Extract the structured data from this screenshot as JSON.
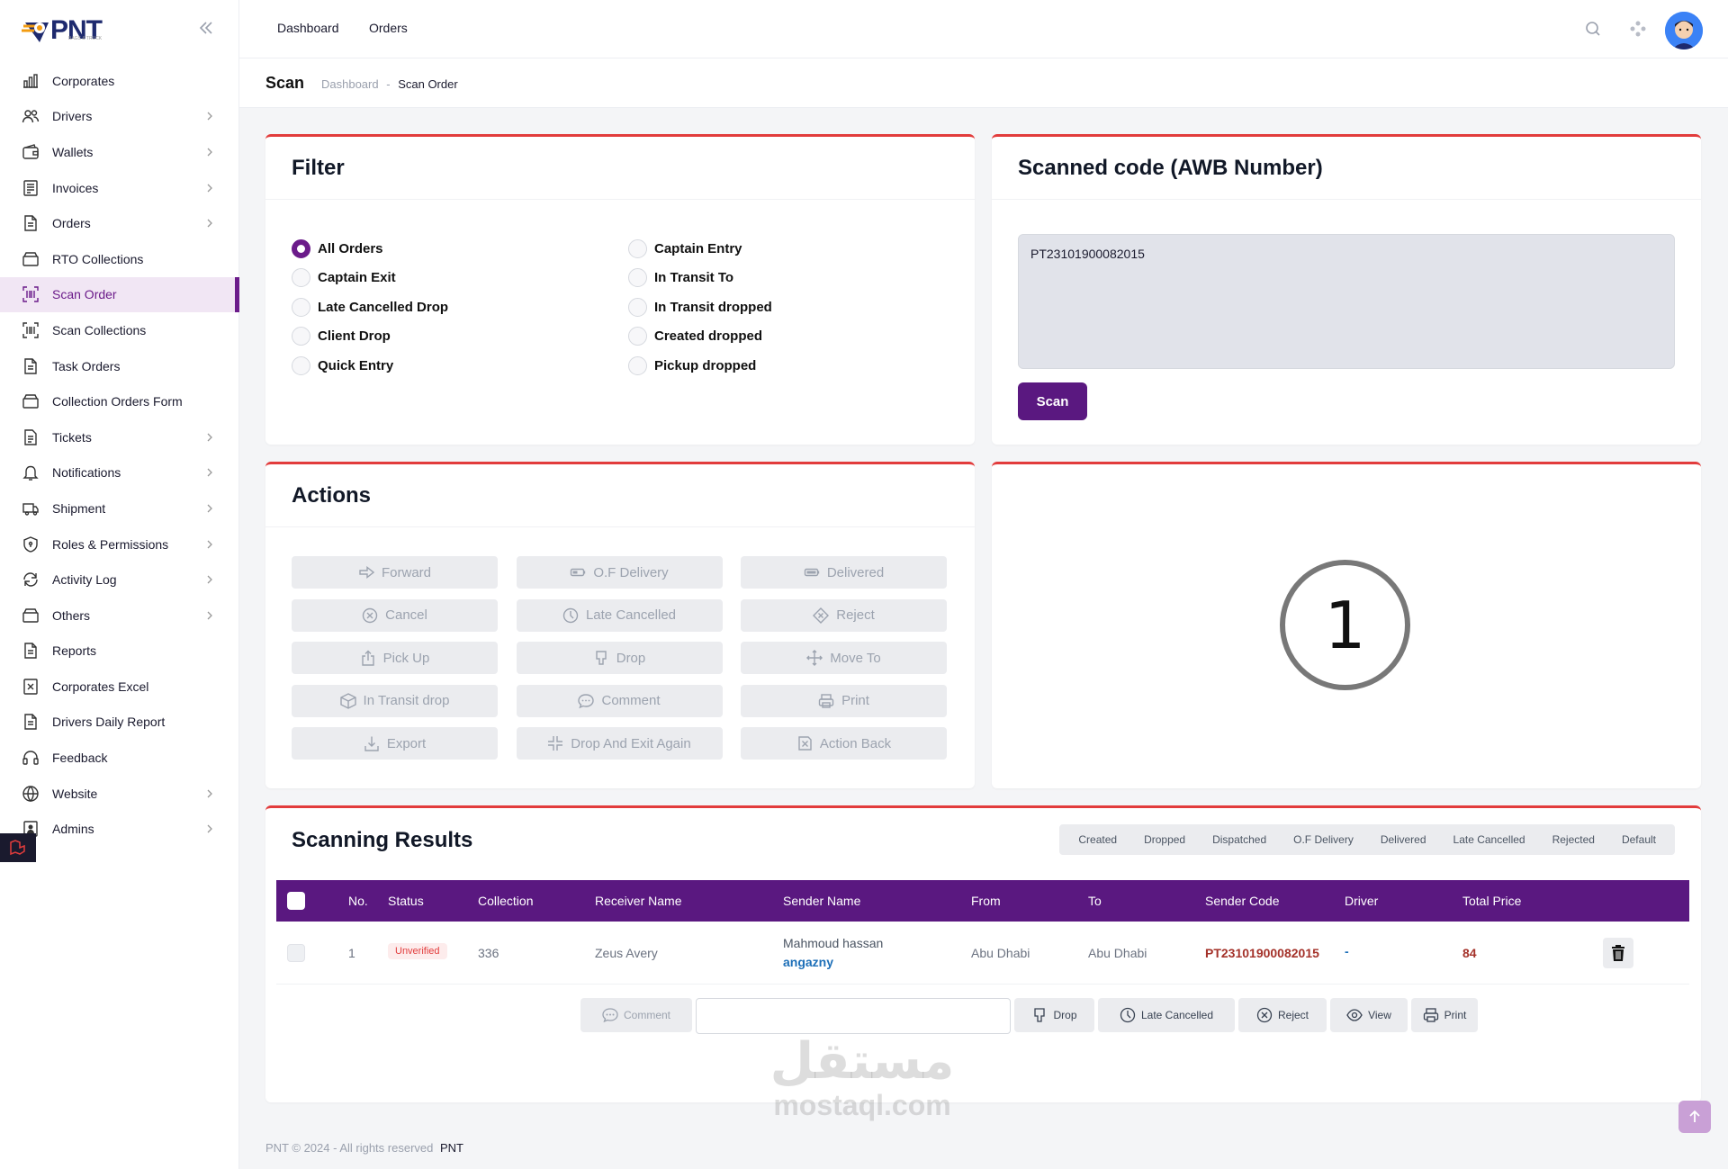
{
  "brand": {
    "logo_text": "PNT",
    "logo_sub": "BAGS & TRUCK",
    "accent": "#5a1880",
    "card_border": "#e23c3c"
  },
  "sidebar": {
    "items": [
      {
        "label": "Corporates",
        "icon": "chart-icon",
        "chevron": false
      },
      {
        "label": "Drivers",
        "icon": "users-icon",
        "chevron": true
      },
      {
        "label": "Wallets",
        "icon": "wallet-icon",
        "chevron": true
      },
      {
        "label": "Invoices",
        "icon": "invoice-icon",
        "chevron": true
      },
      {
        "label": "Orders",
        "icon": "document-icon",
        "chevron": true
      },
      {
        "label": "RTO Collections",
        "icon": "box-icon",
        "chevron": false
      },
      {
        "label": "Scan Order",
        "icon": "barcode-icon",
        "chevron": false,
        "active": true
      },
      {
        "label": "Scan Collections",
        "icon": "barcode-icon",
        "chevron": false
      },
      {
        "label": "Task Orders",
        "icon": "document-icon",
        "chevron": false
      },
      {
        "label": "Collection Orders Form",
        "icon": "box-icon",
        "chevron": false
      },
      {
        "label": "Tickets",
        "icon": "ticket-icon",
        "chevron": true
      },
      {
        "label": "Notifications",
        "icon": "bell-icon",
        "chevron": true
      },
      {
        "label": "Shipment",
        "icon": "truck-icon",
        "chevron": true
      },
      {
        "label": "Roles & Permissions",
        "icon": "shield-icon",
        "chevron": true
      },
      {
        "label": "Activity Log",
        "icon": "refresh-icon",
        "chevron": true
      },
      {
        "label": "Others",
        "icon": "box-icon",
        "chevron": true
      },
      {
        "label": "Reports",
        "icon": "document-icon",
        "chevron": false
      },
      {
        "label": "Corporates Excel",
        "icon": "excel-icon",
        "chevron": false
      },
      {
        "label": "Drivers Daily Report",
        "icon": "document-icon",
        "chevron": false
      },
      {
        "label": "Feedback",
        "icon": "headset-icon",
        "chevron": false
      },
      {
        "label": "Website",
        "icon": "globe-icon",
        "chevron": true
      },
      {
        "label": "Admins",
        "icon": "admin-icon",
        "chevron": true
      }
    ]
  },
  "topbar": {
    "links": [
      "Dashboard",
      "Orders"
    ]
  },
  "breadcrumb": {
    "title": "Scan",
    "parent": "Dashboard",
    "separator": "-",
    "current": "Scan Order"
  },
  "filter": {
    "title": "Filter",
    "left": [
      {
        "label": "All Orders",
        "checked": true
      },
      {
        "label": "Captain Exit"
      },
      {
        "label": "Late Cancelled Drop"
      },
      {
        "label": "Client Drop"
      },
      {
        "label": "Quick Entry"
      }
    ],
    "right": [
      {
        "label": "Captain Entry"
      },
      {
        "label": "In Transit To"
      },
      {
        "label": "In Transit dropped"
      },
      {
        "label": "Created dropped"
      },
      {
        "label": "Pickup dropped"
      }
    ]
  },
  "scan": {
    "title": "Scanned code (AWB Number)",
    "value": "PT23101900082015",
    "button": "Scan"
  },
  "actions": {
    "title": "Actions",
    "buttons": [
      {
        "label": "Forward",
        "icon": "forward-icon"
      },
      {
        "label": "O.F Delivery",
        "icon": "battery-half-icon"
      },
      {
        "label": "Delivered",
        "icon": "battery-full-icon"
      },
      {
        "label": "Cancel",
        "icon": "cancel-icon"
      },
      {
        "label": "Late Cancelled",
        "icon": "clock-icon"
      },
      {
        "label": "Reject",
        "icon": "reject-icon"
      },
      {
        "label": "Pick Up",
        "icon": "upload-icon"
      },
      {
        "label": "Drop",
        "icon": "drop-icon"
      },
      {
        "label": "Move To",
        "icon": "move-icon"
      },
      {
        "label": "In Transit drop",
        "icon": "package-icon"
      },
      {
        "label": "Comment",
        "icon": "comment-icon"
      },
      {
        "label": "Print",
        "icon": "print-icon"
      },
      {
        "label": "Export",
        "icon": "download-icon"
      },
      {
        "label": "Drop And Exit Again",
        "icon": "compress-icon"
      },
      {
        "label": "Action Back",
        "icon": "action-back-icon"
      }
    ]
  },
  "counter": {
    "value": "1"
  },
  "results": {
    "title": "Scanning Results",
    "filters": [
      "Created",
      "Dropped",
      "Dispatched",
      "O.F Delivery",
      "Delivered",
      "Late Cancelled",
      "Rejected",
      "Default"
    ],
    "columns": [
      "No.",
      "Status",
      "Collection",
      "Receiver Name",
      "Sender Name",
      "From",
      "To",
      "Sender Code",
      "Driver",
      "Total Price"
    ],
    "rows": [
      {
        "no": "1",
        "status": "Unverified",
        "collection": "336",
        "receiver": "Zeus Avery",
        "sender_name": "Mahmoud hassan",
        "sender_company": "angazny",
        "from": "Abu Dhabi",
        "to": "Abu Dhabi",
        "sender_code": "PT23101900082015",
        "driver": "-",
        "total_price": "84"
      }
    ],
    "row_actions": {
      "comment": "Comment",
      "comment_value": "",
      "drop": "Drop",
      "late_cancelled": "Late Cancelled",
      "reject": "Reject",
      "view": "View",
      "print": "Print"
    }
  },
  "footer": {
    "text": "PNT © 2024 - All rights reserved",
    "brand": "PNT"
  },
  "watermark": {
    "arabic": "مستقل",
    "latin": "mostaql.com"
  }
}
